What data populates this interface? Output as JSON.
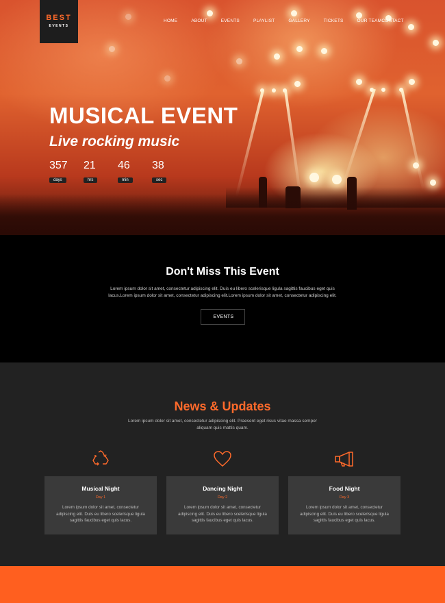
{
  "logo": {
    "line1": "BEST",
    "line2": "EVENTS"
  },
  "nav": [
    "HOME",
    "ABOUT",
    "EVENTS",
    "PLAYLIST",
    "GALLERY",
    "TICKETS",
    "OUR TEAM",
    "CONTACT"
  ],
  "hero": {
    "title": "MUSICAL EVENT",
    "subtitle": "Live rocking music",
    "countdown": [
      {
        "value": "357",
        "label": "days"
      },
      {
        "value": "21",
        "label": "hrs"
      },
      {
        "value": "46",
        "label": "min"
      },
      {
        "value": "38",
        "label": "sec"
      }
    ]
  },
  "miss": {
    "title": "Don't Miss This Event",
    "text": "Lorem ipsum dolor sit amet, consectetur adipiscing elit. Duis eu libero scelerisque ligula sagittis faucibus eget quis lacus.Lorem ipsum dolor sit amet, consectetur adipiscing elit.Lorem ipsum dolor sit amet, consectetur adipiscing elit.",
    "button": "EVENTS"
  },
  "news": {
    "title": "News & Updates",
    "lead": "Lorem ipsum dolor sit amet, consectetur adipiscing elit. Praesent eget risus vitae massa semper aliquam quis mattis quam.",
    "cards": [
      {
        "title": "Musical Night",
        "day": "Day 1",
        "text": "Lorem ipsum dolor sit amet, consectetur adipiscing elit. Duis eu libero scelerisque ligula sagittis faucibus eget quis lacus.",
        "icon": "recycle-icon"
      },
      {
        "title": "Dancing Night",
        "day": "Day 2",
        "text": "Lorem ipsum dolor sit amet, consectetur adipiscing elit. Duis eu libero scelerisque ligula sagittis faucibus eget quis lacus.",
        "icon": "heart-icon"
      },
      {
        "title": "Food Night",
        "day": "Day 3",
        "text": "Lorem ipsum dolor sit amet, consectetur adipiscing elit. Duis eu libero scelerisque ligula sagittis faucibus eget quis lacus.",
        "icon": "megaphone-icon"
      }
    ]
  },
  "colors": {
    "accent": "#ff6a2b",
    "dark": "#222222",
    "black": "#000000",
    "card": "#3a3a3a"
  }
}
